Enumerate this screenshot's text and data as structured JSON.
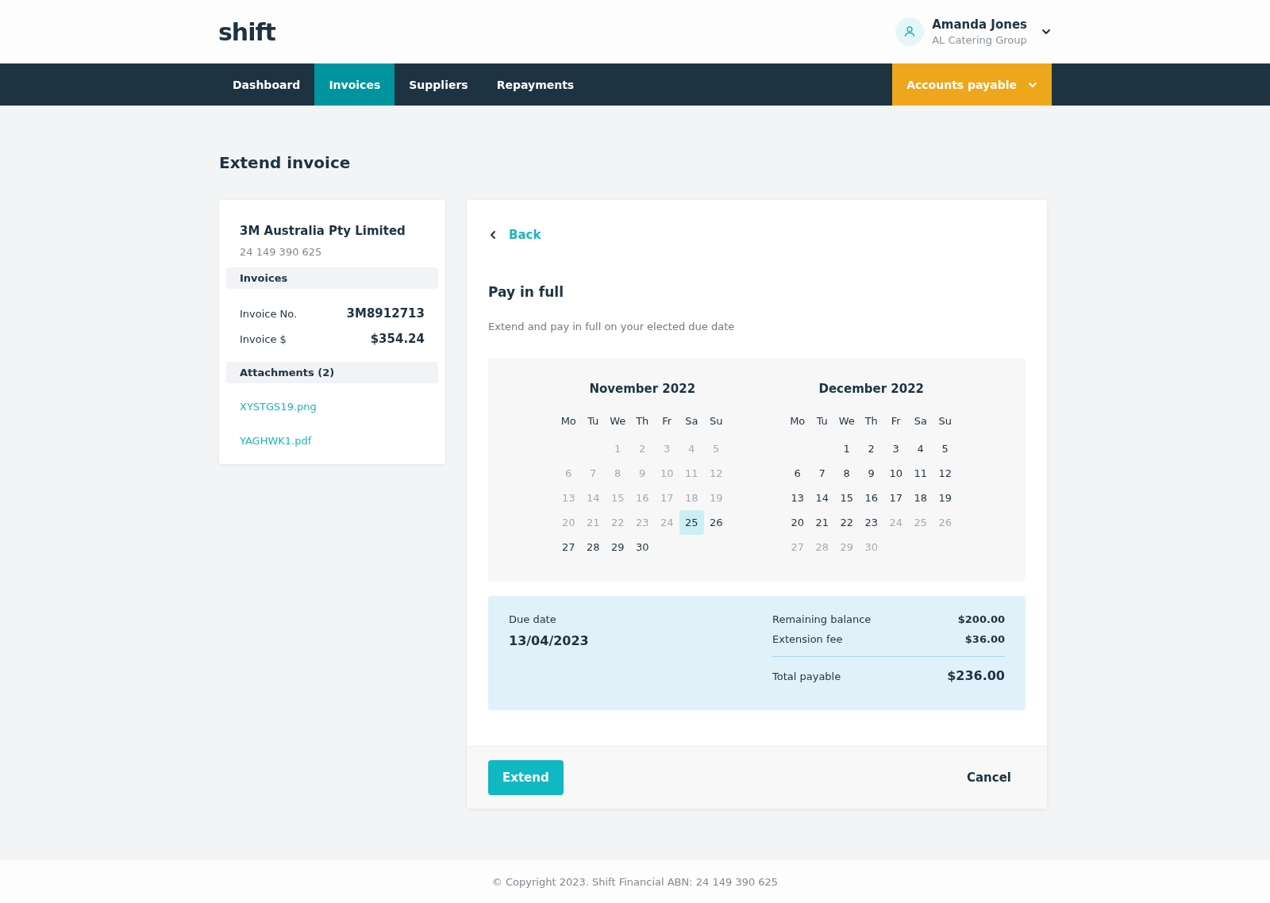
{
  "logo": "shift",
  "user": {
    "name": "Amanda Jones",
    "company": "AL Catering Group"
  },
  "nav": [
    {
      "label": "Dashboard",
      "selected": false
    },
    {
      "label": "Invoices",
      "selected": true
    },
    {
      "label": "Suppliers",
      "selected": false
    },
    {
      "label": "Repayments",
      "selected": false
    }
  ],
  "nav_action": "Accounts payable",
  "page_title": "Extend invoice",
  "supplier": {
    "name": "3M Australia Pty Limited",
    "abn": "24 149 390 625",
    "invoices_heading": "Invoices",
    "fields": [
      {
        "label": "Invoice No.",
        "value": "3M8912713"
      },
      {
        "label": "Invoice $",
        "value": "$354.24"
      }
    ],
    "attachments_heading": "Attachments (2)",
    "attachments": [
      "XYSTGS19.png",
      "YAGHWK1.pdf"
    ]
  },
  "back": "Back",
  "option_title": "Pay in full",
  "option_description": "Extend and pay in full on your elected due date",
  "calendars": [
    {
      "month": "November 2022",
      "weekdays": [
        "Mo",
        "Tu",
        "We",
        "Th",
        "Fr",
        "Sa",
        "Su"
      ],
      "weeks": [
        [
          {
            "d": "1",
            "disabled": true,
            "selected": false
          },
          {
            "d": "2",
            "disabled": true,
            "selected": false
          },
          {
            "d": "3",
            "disabled": true,
            "selected": false
          },
          {
            "d": "4",
            "disabled": true,
            "selected": false
          },
          {
            "d": "5",
            "disabled": true,
            "selected": false
          }
        ],
        [
          {
            "d": "6",
            "disabled": true,
            "selected": false
          },
          {
            "d": "7",
            "disabled": true,
            "selected": false
          },
          {
            "d": "8",
            "disabled": true,
            "selected": false
          },
          {
            "d": "9",
            "disabled": true,
            "selected": false
          },
          {
            "d": "10",
            "disabled": true,
            "selected": false
          },
          {
            "d": "11",
            "disabled": true,
            "selected": false
          },
          {
            "d": "12",
            "disabled": true,
            "selected": false
          }
        ],
        [
          {
            "d": "13",
            "disabled": true,
            "selected": false
          },
          {
            "d": "14",
            "disabled": true,
            "selected": false
          },
          {
            "d": "15",
            "disabled": true,
            "selected": false
          },
          {
            "d": "16",
            "disabled": true,
            "selected": false
          },
          {
            "d": "17",
            "disabled": true,
            "selected": false
          },
          {
            "d": "18",
            "disabled": true,
            "selected": false
          },
          {
            "d": "19",
            "disabled": true,
            "selected": false
          }
        ],
        [
          {
            "d": "20",
            "disabled": true,
            "selected": false
          },
          {
            "d": "21",
            "disabled": true,
            "selected": false
          },
          {
            "d": "22",
            "disabled": true,
            "selected": false
          },
          {
            "d": "23",
            "disabled": true,
            "selected": false
          },
          {
            "d": "24",
            "disabled": true,
            "selected": false
          },
          {
            "d": "25",
            "disabled": false,
            "selected": true
          },
          {
            "d": "26",
            "disabled": false,
            "selected": false
          }
        ],
        [
          {
            "d": "27",
            "disabled": false,
            "selected": false
          },
          {
            "d": "28",
            "disabled": false,
            "selected": false
          },
          {
            "d": "29",
            "disabled": false,
            "selected": false
          },
          {
            "d": "30",
            "disabled": false,
            "selected": false
          }
        ]
      ]
    },
    {
      "month": "December 2022",
      "weekdays": [
        "Mo",
        "Tu",
        "We",
        "Th",
        "Fr",
        "Sa",
        "Su"
      ],
      "weeks": [
        [
          {
            "d": "1",
            "disabled": false,
            "selected": false
          },
          {
            "d": "2",
            "disabled": false,
            "selected": false
          },
          {
            "d": "3",
            "disabled": false,
            "selected": false
          },
          {
            "d": "4",
            "disabled": false,
            "selected": false
          },
          {
            "d": "5",
            "disabled": false,
            "selected": false
          }
        ],
        [
          {
            "d": "6",
            "disabled": false,
            "selected": false
          },
          {
            "d": "7",
            "disabled": false,
            "selected": false
          },
          {
            "d": "8",
            "disabled": false,
            "selected": false
          },
          {
            "d": "9",
            "disabled": false,
            "selected": false
          },
          {
            "d": "10",
            "disabled": false,
            "selected": false
          },
          {
            "d": "11",
            "disabled": false,
            "selected": false
          },
          {
            "d": "12",
            "disabled": false,
            "selected": false
          }
        ],
        [
          {
            "d": "13",
            "disabled": false,
            "selected": false
          },
          {
            "d": "14",
            "disabled": false,
            "selected": false
          },
          {
            "d": "15",
            "disabled": false,
            "selected": false
          },
          {
            "d": "16",
            "disabled": false,
            "selected": false
          },
          {
            "d": "17",
            "disabled": false,
            "selected": false
          },
          {
            "d": "18",
            "disabled": false,
            "selected": false
          },
          {
            "d": "19",
            "disabled": false,
            "selected": false
          }
        ],
        [
          {
            "d": "20",
            "disabled": false,
            "selected": false
          },
          {
            "d": "21",
            "disabled": false,
            "selected": false
          },
          {
            "d": "22",
            "disabled": false,
            "selected": false
          },
          {
            "d": "23",
            "disabled": false,
            "selected": false
          },
          {
            "d": "24",
            "disabled": true,
            "selected": false
          },
          {
            "d": "25",
            "disabled": true,
            "selected": false
          },
          {
            "d": "26",
            "disabled": true,
            "selected": false
          }
        ],
        [
          {
            "d": "27",
            "disabled": true,
            "selected": false
          },
          {
            "d": "28",
            "disabled": true,
            "selected": false
          },
          {
            "d": "29",
            "disabled": true,
            "selected": false
          },
          {
            "d": "30",
            "disabled": true,
            "selected": false
          }
        ]
      ]
    }
  ],
  "summary": {
    "due_label": "Due date",
    "due_value": "13/04/2023",
    "lines": [
      {
        "label": "Remaining balance",
        "value": "$200.00"
      },
      {
        "label": "Extension fee",
        "value": "$36.00"
      }
    ],
    "total": {
      "label": "Total payable",
      "value": "$236.00"
    }
  },
  "buttons": {
    "primary": "Extend",
    "secondary": "Cancel"
  },
  "footer": "© Copyright 2023. Shift Financial ABN: 24 149 390 625"
}
